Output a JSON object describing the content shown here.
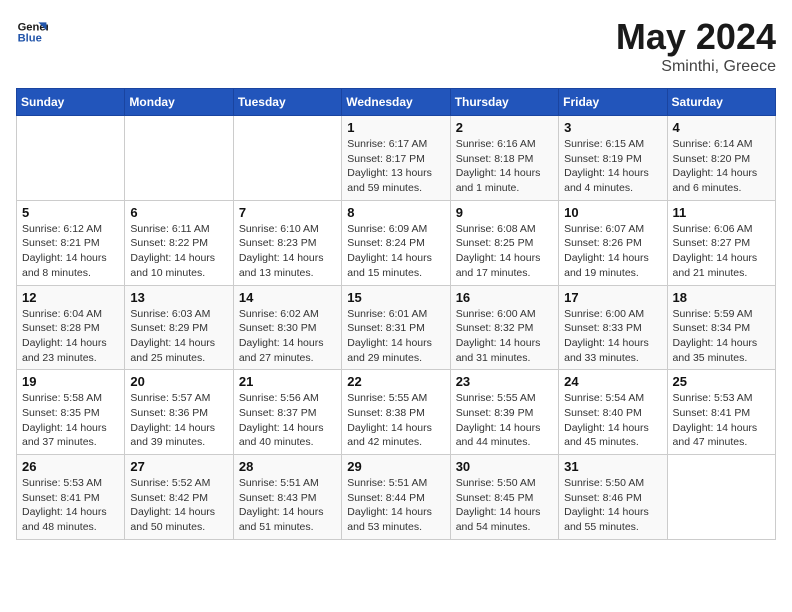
{
  "header": {
    "logo_line1": "General",
    "logo_line2": "Blue",
    "month": "May 2024",
    "location": "Sminthi, Greece"
  },
  "weekdays": [
    "Sunday",
    "Monday",
    "Tuesday",
    "Wednesday",
    "Thursday",
    "Friday",
    "Saturday"
  ],
  "weeks": [
    [
      {
        "day": "",
        "info": ""
      },
      {
        "day": "",
        "info": ""
      },
      {
        "day": "",
        "info": ""
      },
      {
        "day": "1",
        "info": "Sunrise: 6:17 AM\nSunset: 8:17 PM\nDaylight: 13 hours and 59 minutes."
      },
      {
        "day": "2",
        "info": "Sunrise: 6:16 AM\nSunset: 8:18 PM\nDaylight: 14 hours and 1 minute."
      },
      {
        "day": "3",
        "info": "Sunrise: 6:15 AM\nSunset: 8:19 PM\nDaylight: 14 hours and 4 minutes."
      },
      {
        "day": "4",
        "info": "Sunrise: 6:14 AM\nSunset: 8:20 PM\nDaylight: 14 hours and 6 minutes."
      }
    ],
    [
      {
        "day": "5",
        "info": "Sunrise: 6:12 AM\nSunset: 8:21 PM\nDaylight: 14 hours and 8 minutes."
      },
      {
        "day": "6",
        "info": "Sunrise: 6:11 AM\nSunset: 8:22 PM\nDaylight: 14 hours and 10 minutes."
      },
      {
        "day": "7",
        "info": "Sunrise: 6:10 AM\nSunset: 8:23 PM\nDaylight: 14 hours and 13 minutes."
      },
      {
        "day": "8",
        "info": "Sunrise: 6:09 AM\nSunset: 8:24 PM\nDaylight: 14 hours and 15 minutes."
      },
      {
        "day": "9",
        "info": "Sunrise: 6:08 AM\nSunset: 8:25 PM\nDaylight: 14 hours and 17 minutes."
      },
      {
        "day": "10",
        "info": "Sunrise: 6:07 AM\nSunset: 8:26 PM\nDaylight: 14 hours and 19 minutes."
      },
      {
        "day": "11",
        "info": "Sunrise: 6:06 AM\nSunset: 8:27 PM\nDaylight: 14 hours and 21 minutes."
      }
    ],
    [
      {
        "day": "12",
        "info": "Sunrise: 6:04 AM\nSunset: 8:28 PM\nDaylight: 14 hours and 23 minutes."
      },
      {
        "day": "13",
        "info": "Sunrise: 6:03 AM\nSunset: 8:29 PM\nDaylight: 14 hours and 25 minutes."
      },
      {
        "day": "14",
        "info": "Sunrise: 6:02 AM\nSunset: 8:30 PM\nDaylight: 14 hours and 27 minutes."
      },
      {
        "day": "15",
        "info": "Sunrise: 6:01 AM\nSunset: 8:31 PM\nDaylight: 14 hours and 29 minutes."
      },
      {
        "day": "16",
        "info": "Sunrise: 6:00 AM\nSunset: 8:32 PM\nDaylight: 14 hours and 31 minutes."
      },
      {
        "day": "17",
        "info": "Sunrise: 6:00 AM\nSunset: 8:33 PM\nDaylight: 14 hours and 33 minutes."
      },
      {
        "day": "18",
        "info": "Sunrise: 5:59 AM\nSunset: 8:34 PM\nDaylight: 14 hours and 35 minutes."
      }
    ],
    [
      {
        "day": "19",
        "info": "Sunrise: 5:58 AM\nSunset: 8:35 PM\nDaylight: 14 hours and 37 minutes."
      },
      {
        "day": "20",
        "info": "Sunrise: 5:57 AM\nSunset: 8:36 PM\nDaylight: 14 hours and 39 minutes."
      },
      {
        "day": "21",
        "info": "Sunrise: 5:56 AM\nSunset: 8:37 PM\nDaylight: 14 hours and 40 minutes."
      },
      {
        "day": "22",
        "info": "Sunrise: 5:55 AM\nSunset: 8:38 PM\nDaylight: 14 hours and 42 minutes."
      },
      {
        "day": "23",
        "info": "Sunrise: 5:55 AM\nSunset: 8:39 PM\nDaylight: 14 hours and 44 minutes."
      },
      {
        "day": "24",
        "info": "Sunrise: 5:54 AM\nSunset: 8:40 PM\nDaylight: 14 hours and 45 minutes."
      },
      {
        "day": "25",
        "info": "Sunrise: 5:53 AM\nSunset: 8:41 PM\nDaylight: 14 hours and 47 minutes."
      }
    ],
    [
      {
        "day": "26",
        "info": "Sunrise: 5:53 AM\nSunset: 8:41 PM\nDaylight: 14 hours and 48 minutes."
      },
      {
        "day": "27",
        "info": "Sunrise: 5:52 AM\nSunset: 8:42 PM\nDaylight: 14 hours and 50 minutes."
      },
      {
        "day": "28",
        "info": "Sunrise: 5:51 AM\nSunset: 8:43 PM\nDaylight: 14 hours and 51 minutes."
      },
      {
        "day": "29",
        "info": "Sunrise: 5:51 AM\nSunset: 8:44 PM\nDaylight: 14 hours and 53 minutes."
      },
      {
        "day": "30",
        "info": "Sunrise: 5:50 AM\nSunset: 8:45 PM\nDaylight: 14 hours and 54 minutes."
      },
      {
        "day": "31",
        "info": "Sunrise: 5:50 AM\nSunset: 8:46 PM\nDaylight: 14 hours and 55 minutes."
      },
      {
        "day": "",
        "info": ""
      }
    ]
  ]
}
